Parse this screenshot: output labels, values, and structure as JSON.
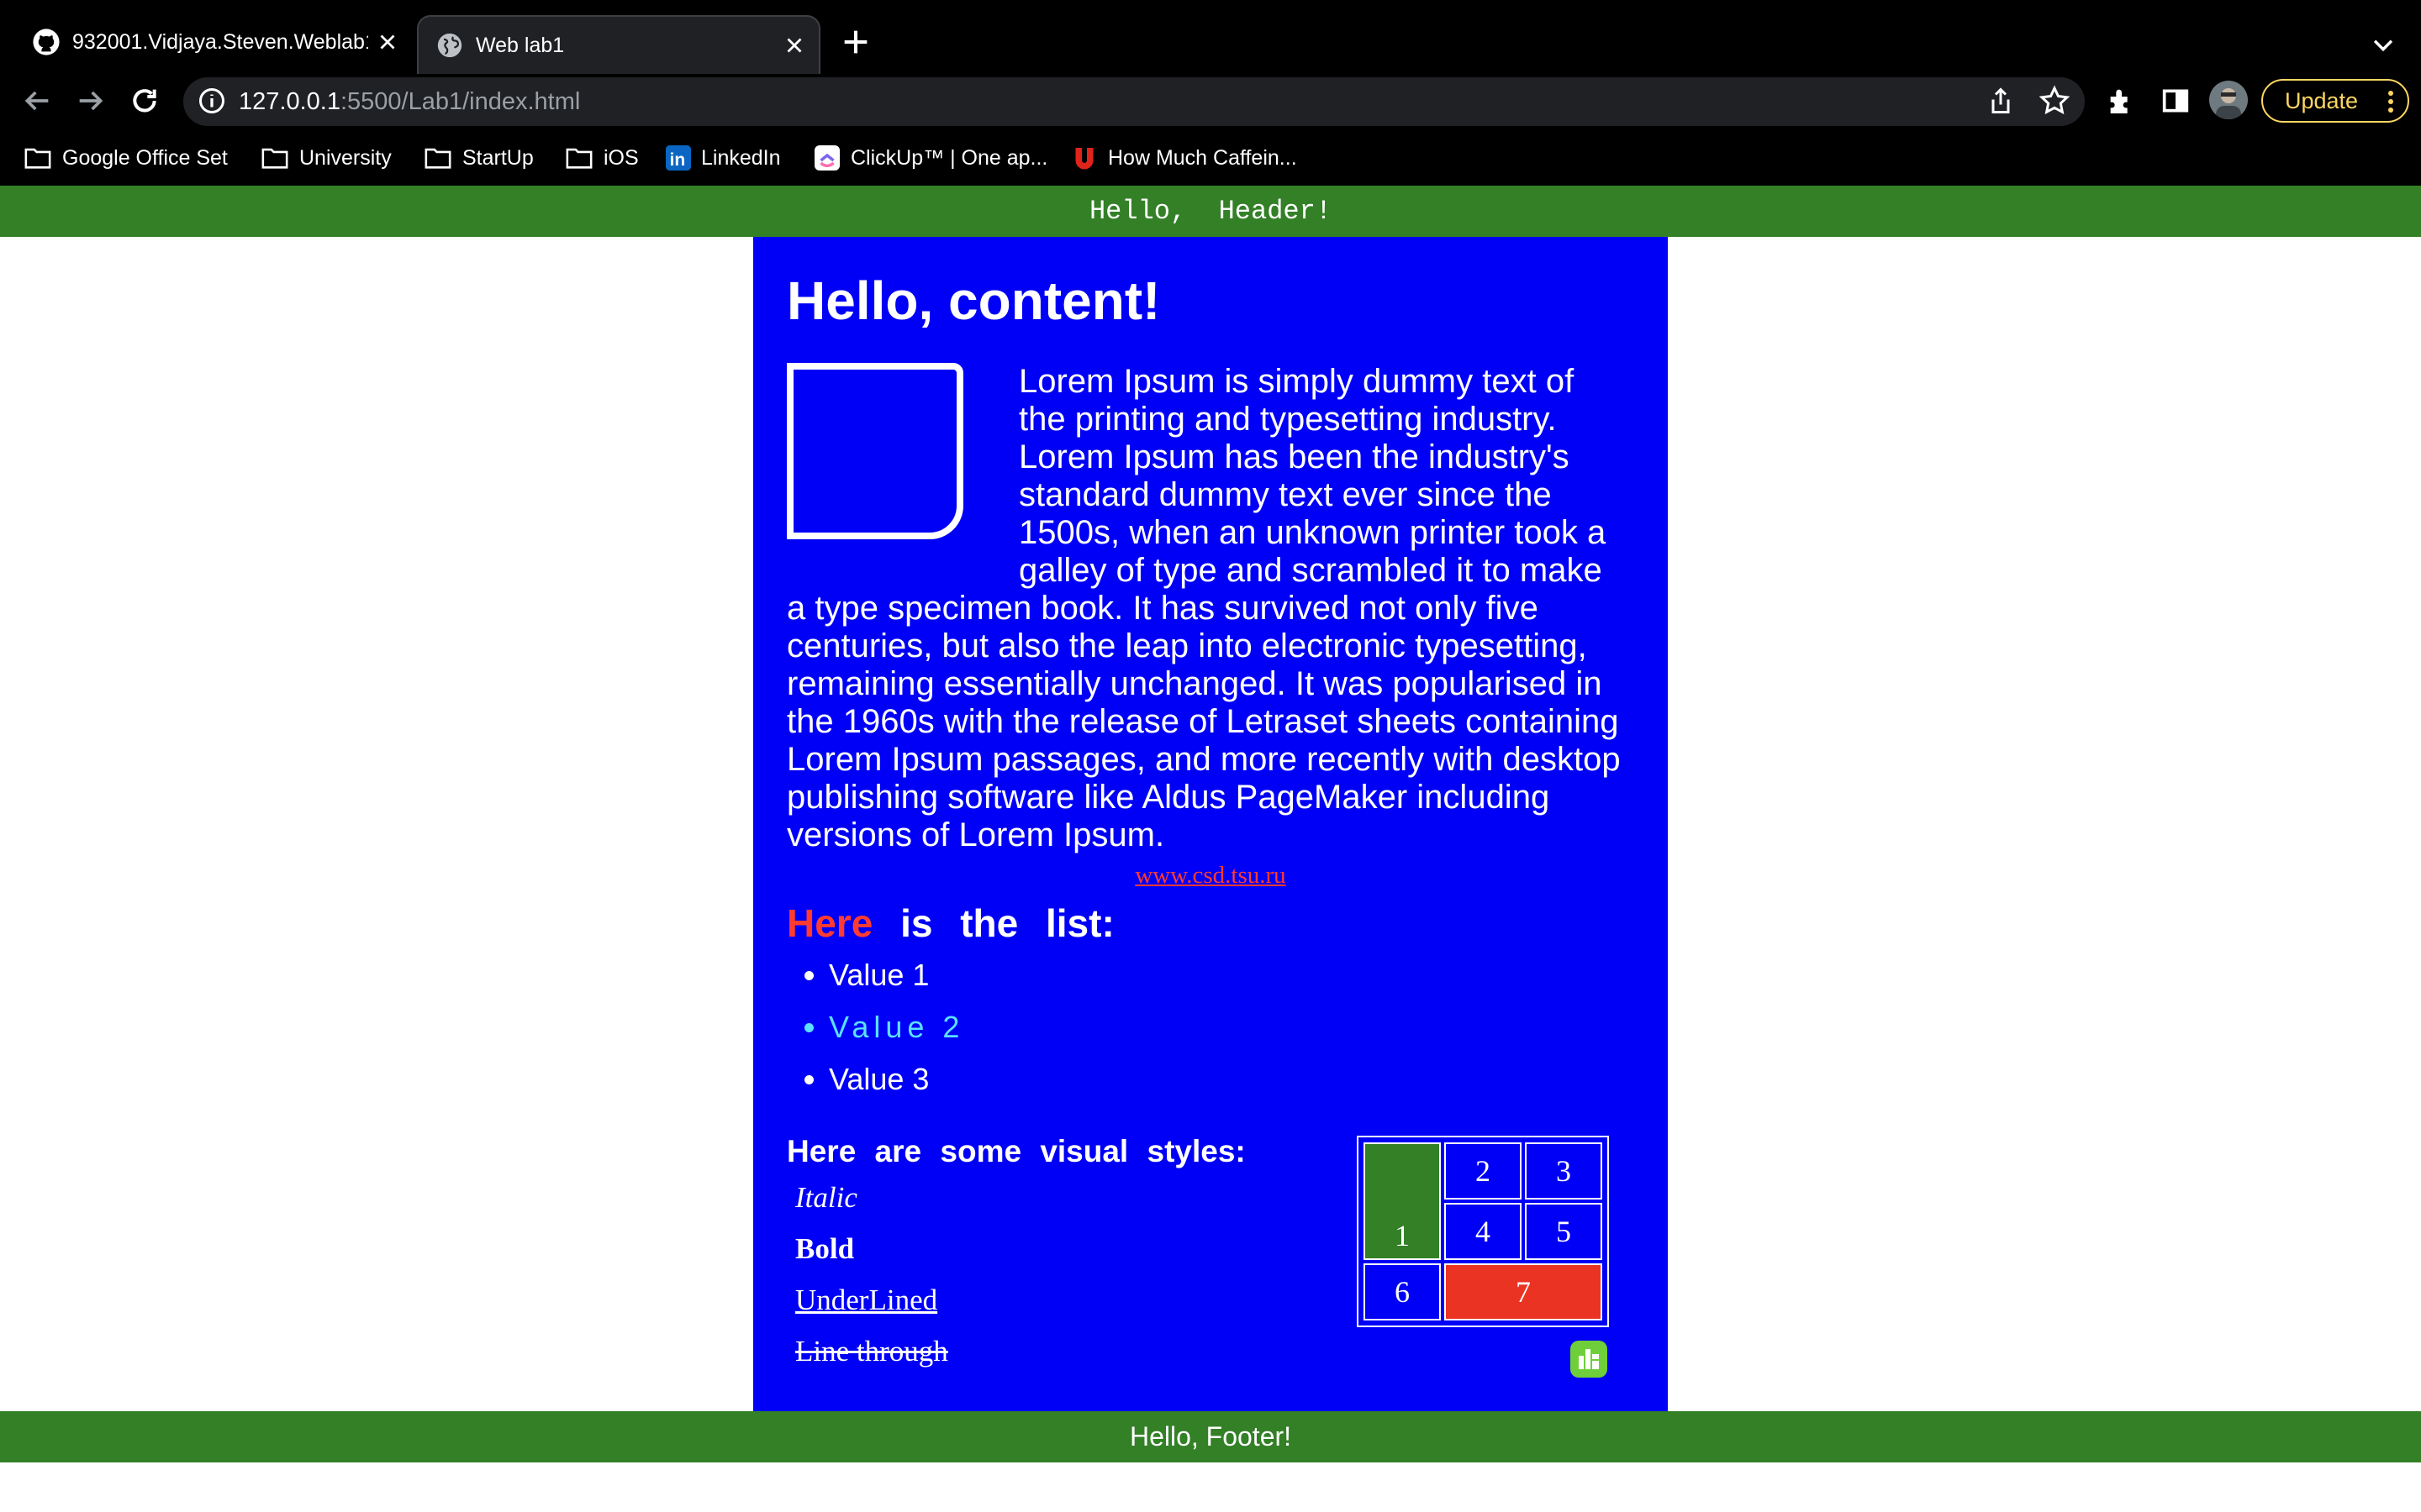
{
  "browser": {
    "tabs": [
      {
        "title": "932001.Vidjaya.Steven.Weblab1",
        "icon": "github-icon",
        "active": false
      },
      {
        "title": "Web lab1",
        "icon": "globe-icon",
        "active": true
      }
    ],
    "url_host": "127.0.0.1",
    "url_path": ":5500/Lab1/index.html",
    "update_label": "Update",
    "bookmarks": [
      {
        "label": "Google Office Set",
        "icon": "folder-icon"
      },
      {
        "label": "University",
        "icon": "folder-icon"
      },
      {
        "label": "StartUp",
        "icon": "folder-icon"
      },
      {
        "label": "iOS",
        "icon": "folder-icon"
      },
      {
        "label": "LinkedIn",
        "icon": "linkedin-icon"
      },
      {
        "label": "ClickUp™ | One ap...",
        "icon": "clickup-icon"
      },
      {
        "label": "How Much Caffein...",
        "icon": "caffeine-icon"
      }
    ],
    "colors": {
      "chrome_bg": "#000000",
      "omnibox_bg": "#202124",
      "update_accent": "#fdd663"
    }
  },
  "page": {
    "header_text": "Hello,  Header!",
    "content_title": "Hello, content!",
    "lorem": "Lorem Ipsum is simply dummy text of the printing and typesetting industry. Lorem Ipsum has been the industry's standard dummy text ever since the 1500s, when an unknown printer took a galley of type and scrambled it to make a type specimen book. It has survived not only five centuries, but also the leap into electronic typesetting, remaining essentially unchanged. It was popularised in the 1960s with the release of Letraset sheets containing Lorem Ipsum passages, and more recently with desktop publishing software like Aldus PageMaker including versions of Lorem Ipsum.",
    "link_text": "www.csd.tsu.ru",
    "list_heading_highlight": "Here",
    "list_heading_rest": " is the list:",
    "list_items": [
      "Value 1",
      "Value 2",
      "Value 3"
    ],
    "styles_heading": "Here are some visual styles:",
    "styles": {
      "italic": "Italic",
      "bold": "Bold",
      "underline": "UnderLined",
      "strike": "Line through"
    },
    "table_cells": [
      "1",
      "2",
      "3",
      "4",
      "5",
      "6",
      "7"
    ],
    "footer_text": "Hello, Footer!",
    "colors": {
      "header_footer": "#338027",
      "content_bg": "#0000f6",
      "highlight_red": "#ff3b30",
      "cell_red": "#ea3323",
      "list_alt": "#5ce0ff"
    }
  }
}
